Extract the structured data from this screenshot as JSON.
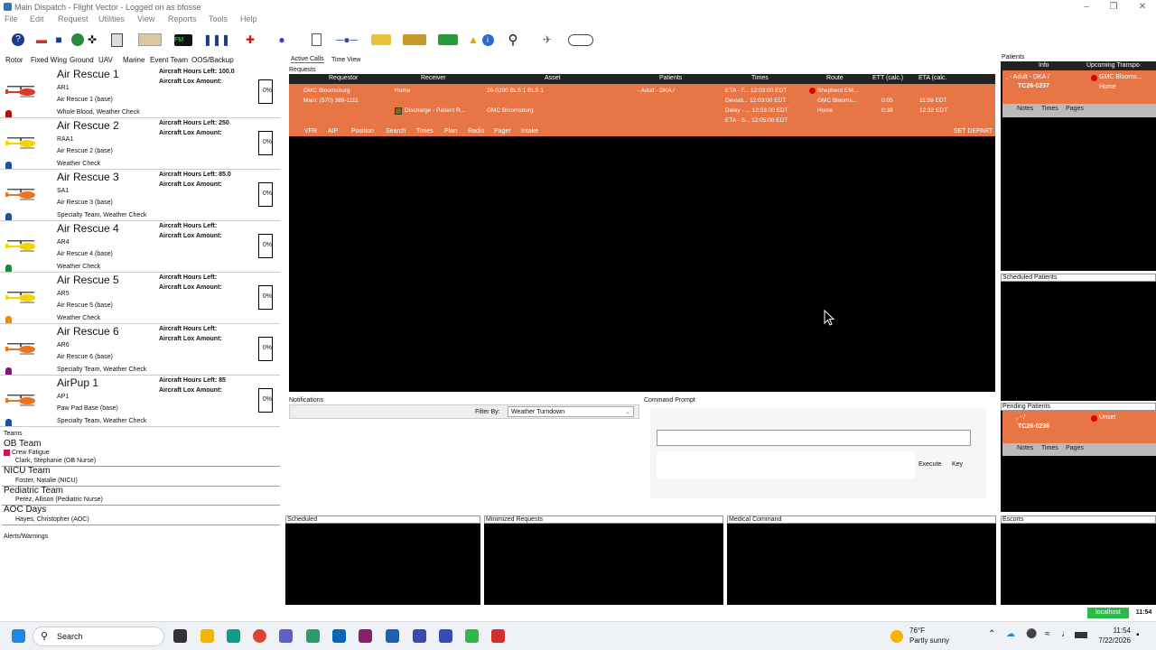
{
  "window": {
    "title": "Main Dispatch - Flight Vector - Logged on as bfosse"
  },
  "menu": [
    "File",
    "Edit",
    "Request",
    "Utilities",
    "View",
    "Reports",
    "Tools",
    "Help"
  ],
  "left_tabs": [
    "Rotor",
    "Fixed Wing",
    "Ground",
    "UAV",
    "Marine",
    "Event Team",
    "OOS/Backup"
  ],
  "aircraft": [
    {
      "name": "Air Rescue 1",
      "code": "AR1",
      "base": "Air Rescue 1 (base)",
      "caps": "Whole Blood, Weather Check",
      "hours": "Aircraft Hours Left: 100.0",
      "lox": "Aircraft Lox Amount:",
      "gauge": "0%",
      "color": "#d83a2a",
      "dot": "#b01010"
    },
    {
      "name": "Air Rescue 2",
      "code": "RAA1",
      "base": "Air Rescue 2 (base)",
      "caps": "Weather Check",
      "hours": "Aircraft Hours Left: 250",
      "lox": "Aircraft Lox Amount:",
      "gauge": "0%",
      "color": "#f3d500",
      "dot": "#1e4fa0"
    },
    {
      "name": "Air Rescue 3",
      "code": "SA1",
      "base": "Air Rescue 3 (base)",
      "caps": "Specialty Team, Weather Check",
      "hours": "Aircraft Hours Left: 85.0",
      "lox": "Aircraft Lox Amount:",
      "gauge": "0%",
      "color": "#e8761e",
      "dot": "#1e4fa0"
    },
    {
      "name": "Air Rescue 4",
      "code": "AR4",
      "base": "Air Rescue 4 (base)",
      "caps": "Weather Check",
      "hours": "Aircraft Hours Left:",
      "lox": "Aircraft Lox Amount:",
      "gauge": "0%",
      "color": "#f3d500",
      "dot": "#1a8a3a"
    },
    {
      "name": "Air Rescue 5",
      "code": "AR5",
      "base": "Air Rescue 5 (base)",
      "caps": "Weather Check",
      "hours": "Aircraft Hours Left:",
      "lox": "Aircraft Lox Amount:",
      "gauge": "0%",
      "color": "#f3d500",
      "dot": "#e88a10"
    },
    {
      "name": "Air Rescue 6",
      "code": "AR6",
      "base": "Air Rescue 6 (base)",
      "caps": "Specialty Team, Weather Check",
      "hours": "Aircraft Hours Left:",
      "lox": "Aircraft Lox Amount:",
      "gauge": "0%",
      "color": "#e8761e",
      "dot": "#7a1a7a"
    },
    {
      "name": "AirPup 1",
      "code": "AP1",
      "base": "Paw Pad Base (base)",
      "caps": "Specialty Team, Weather Check",
      "hours": "Aircraft Hours Left: 85",
      "lox": "Aircraft Lox Amount:",
      "gauge": "0%",
      "color": "#e8761e",
      "dot": "#1e4fa0"
    }
  ],
  "teams": {
    "label": "Teams",
    "ob": {
      "name": "OB Team",
      "badge": "Crew Fatigue",
      "member": "Clark, Stephanie (OB Nurse)"
    },
    "nicu": {
      "name": "NICU Team",
      "member": "Foster, Natalie (NICU)"
    },
    "peds": {
      "name": "Pediatric Team",
      "member": "Perez, Allison (Pediatric Nurse)"
    },
    "aoc": {
      "name": "AOC Days",
      "member": "Hayes, Christopher (AOC)"
    },
    "alerts": "Alerts/Warnings"
  },
  "mid_tabs": {
    "active": "Active Calls",
    "timeview": "Time View",
    "requests": "Requests"
  },
  "requests": {
    "headers": [
      "Requestor",
      "Receiver",
      "Asset",
      "Patients",
      "Times",
      "Route",
      "ETT (calc.)",
      "ETA (calc."
    ],
    "row": {
      "requestor": "GMC Bloomsburg",
      "phone": "Main: (570) 389-1111",
      "receiver": "Home",
      "receiver2": "Discharge - Patient R...",
      "asset": "26-0200 BLS 1 BLS 1",
      "asset2": "GMC Bloomsburg",
      "patients": "- Adult - DKA /",
      "times": [
        "ETA - F...  12:03:00 EDT",
        "Deviati...  12:03:00 EDT",
        "Delay - ...  12:03:00 EDT",
        "ETA - S...  12:05:00 EDT"
      ],
      "route": [
        "Shepherd EM...",
        "GMC Blooms...",
        "Home"
      ],
      "ett": [
        "0:05",
        "0:38"
      ],
      "eta": [
        "11:59 EDT",
        "12:32 EDT"
      ]
    },
    "actions": [
      "VFR",
      "AIP",
      "Position",
      "Search",
      "Times",
      "Plan",
      "Radio",
      "Pager",
      "Intake"
    ],
    "set_depart": "SET DEPART"
  },
  "notifications": {
    "label": "Notifications",
    "filter_label": "Filter By:",
    "filter_value": "Weather Turndown"
  },
  "command": {
    "label": "Command Prompt",
    "execute": "Execute",
    "key": "Key"
  },
  "panes": {
    "scheduled": "Scheduled",
    "minimized": "Minimized Requests",
    "medical": "Medical Command",
    "escorts": "Escorts"
  },
  "right": {
    "patients": "Patients",
    "headers": [
      "Info",
      "Upcoming Transpo"
    ],
    "card1": {
      "line1": ", - Adult - DKA /",
      "id": "TC26-0237",
      "dest": "GMC Blooms...",
      "dest2": "Home"
    },
    "tabs": [
      "Notes",
      "Times",
      "Pages"
    ],
    "scheduled": "Scheduled Patients",
    "pending": "Pending Patients",
    "card2": {
      "line1": ", - /",
      "id": "TC26-0236",
      "status": "Unset"
    }
  },
  "status": {
    "host": "localhost",
    "time": "11:54"
  },
  "taskbar": {
    "search": "Search",
    "weather_temp": "76°F",
    "weather_desc": "Partly sunny",
    "clock_time": "11:54",
    "clock_date": "7/22/2026"
  }
}
